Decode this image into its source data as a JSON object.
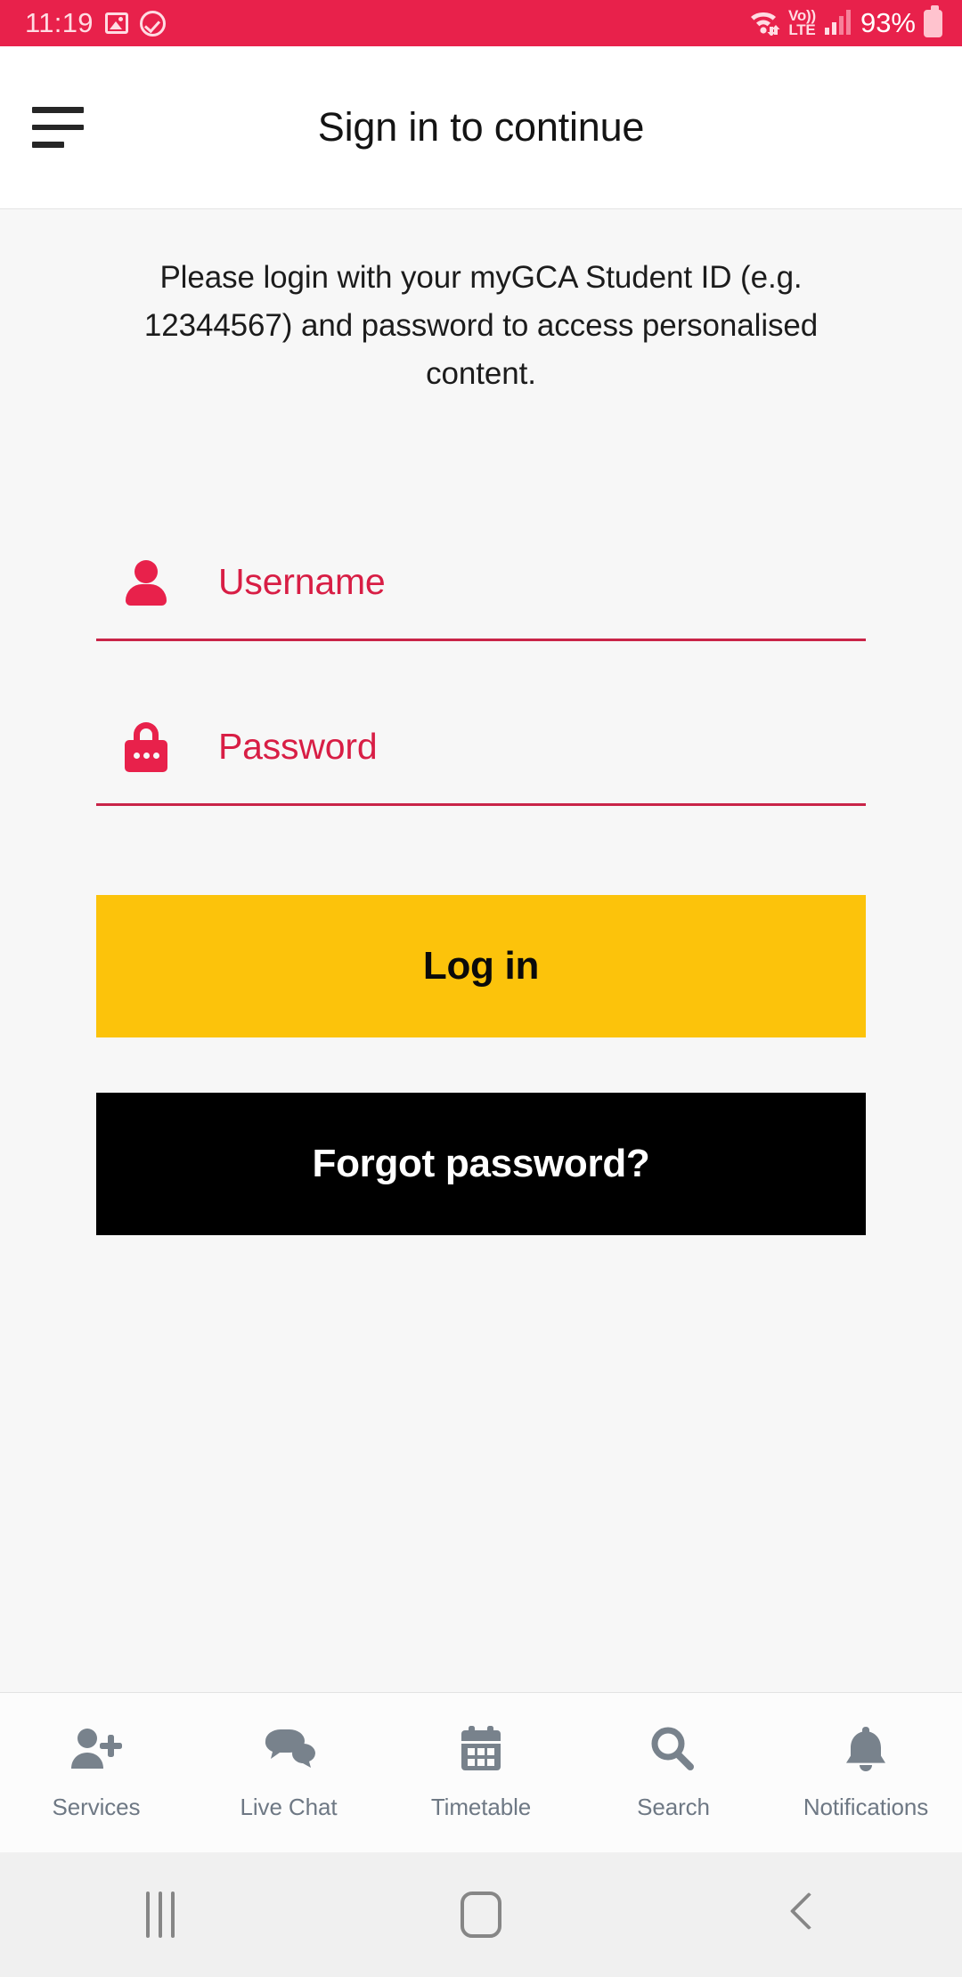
{
  "status_bar": {
    "time": "11:19",
    "left_icons": [
      "image-icon",
      "check-circle-icon"
    ],
    "wifi_icon": "wifi-icon",
    "volte_top": "Vo))",
    "volte_bottom": "LTE",
    "signal_icon": "cellular-signal-icon",
    "battery_percent": "93%",
    "battery_icon": "battery-icon",
    "background_color": "#E8214B"
  },
  "app_bar": {
    "menu_icon": "hamburger-menu-icon",
    "title": "Sign in to continue"
  },
  "main": {
    "intro_text": "Please login with your myGCA Student ID (e.g. 12344567) and password to access personalised content.",
    "username_field": {
      "icon": "person-icon",
      "label": "Username",
      "value": "",
      "placeholder": "Username"
    },
    "password_field": {
      "icon": "lock-icon",
      "label": "Password",
      "value": "",
      "placeholder": "Password"
    },
    "login_button": {
      "label": "Log in",
      "background_color": "#FCC30B",
      "text_color": "#0A0A0A"
    },
    "forgot_button": {
      "label": "Forgot password?",
      "background_color": "#000000",
      "text_color": "#FFFFFF"
    },
    "accent_color": "#E8214B",
    "background_color": "#F7F7F7"
  },
  "bottom_nav": {
    "items": [
      {
        "label": "Services",
        "icon": "person-add-icon"
      },
      {
        "label": "Live Chat",
        "icon": "chat-bubbles-icon"
      },
      {
        "label": "Timetable",
        "icon": "calendar-icon"
      },
      {
        "label": "Search",
        "icon": "search-icon"
      },
      {
        "label": "Notifications",
        "icon": "bell-icon"
      }
    ],
    "icon_color": "#78828C"
  },
  "android_nav": {
    "recent_label": "recent-apps-button",
    "home_label": "home-button",
    "back_label": "back-button"
  }
}
